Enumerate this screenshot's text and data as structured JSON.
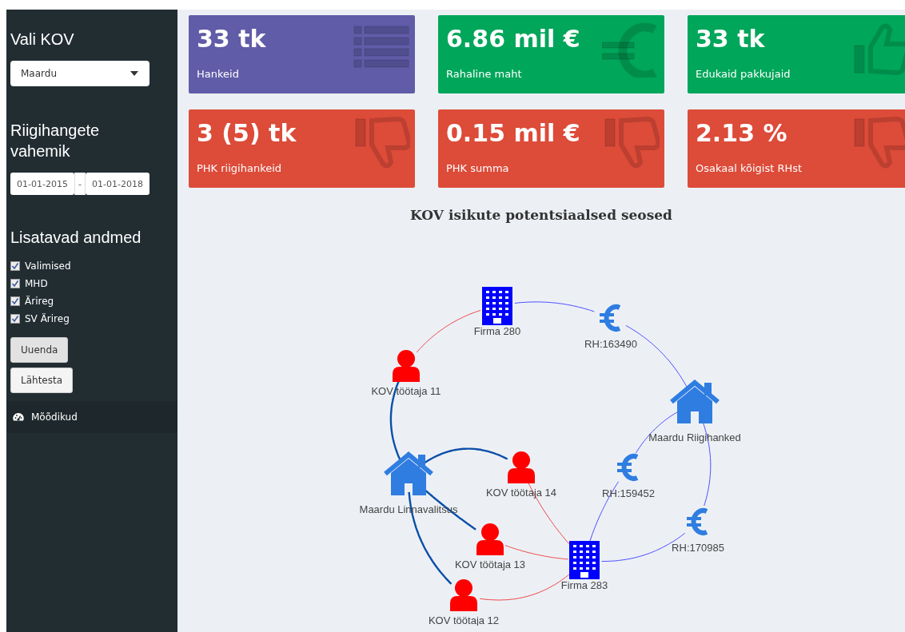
{
  "sidebar": {
    "kov_heading": "Vali KOV",
    "kov_select": {
      "value": "Maardu"
    },
    "range_heading": "Riigihangete vahemik",
    "date_range": {
      "start": "01-01-2015",
      "separator": "-",
      "end": "01-01-2018"
    },
    "data_heading": "Lisatavad andmed",
    "checkboxes": [
      {
        "label": "Valimised",
        "checked": true
      },
      {
        "label": "MHD",
        "checked": true
      },
      {
        "label": "Ärireg",
        "checked": true
      },
      {
        "label": "SV Ärireg",
        "checked": true
      }
    ],
    "buttons": [
      {
        "label": "Uuenda",
        "kind": "pressed"
      },
      {
        "label": "Lähtesta",
        "kind": "plain"
      }
    ],
    "menu": [
      {
        "label": "Mõõdikud",
        "selected": true
      }
    ]
  },
  "value_boxes": [
    {
      "value": "33 tk",
      "label": "Hankeid",
      "color": "#605ca8",
      "kind": "count"
    },
    {
      "value": "6.86 mil €",
      "label": "Rahaline maht",
      "color": "#00a65a",
      "kind": "money"
    },
    {
      "value": "33 tk",
      "label": "Edukaid pakkujaid",
      "color": "#00a65a",
      "kind": "good"
    },
    {
      "value": "3 (5) tk",
      "label": "PHK riigihankeid",
      "color": "#dd4b39",
      "kind": "bad"
    },
    {
      "value": "0.15 mil €",
      "label": "PHK summa",
      "color": "#dd4b39",
      "kind": "bad"
    },
    {
      "value": "2.13 %",
      "label": "Osakaal kõigist RHst",
      "color": "#dd4b39",
      "kind": "bad"
    }
  ],
  "network": {
    "title": "KOV isikute potentsiaalsed seosed",
    "nodes": [
      {
        "kind": "company",
        "label": "Firma 280"
      },
      {
        "kind": "procurement",
        "label": "RH:163490"
      },
      {
        "kind": "person",
        "label": "KOV töötaja 11"
      },
      {
        "kind": "authority",
        "label": "Maardu Riigihanked"
      },
      {
        "kind": "authority",
        "label": "Maardu Linnavalitsus"
      },
      {
        "kind": "person",
        "label": "KOV töötaja 14"
      },
      {
        "kind": "procurement",
        "label": "RH:159452"
      },
      {
        "kind": "procurement",
        "label": "RH:170985"
      },
      {
        "kind": "person",
        "label": "KOV töötaja 13"
      },
      {
        "kind": "company",
        "label": "Firma 283"
      },
      {
        "kind": "person",
        "label": "KOV töötaja 12"
      }
    ],
    "edges": [
      {
        "kind": "procurement"
      },
      {
        "kind": "procurement"
      },
      {
        "kind": "association"
      },
      {
        "kind": "employment"
      },
      {
        "kind": "employment"
      },
      {
        "kind": "employment"
      },
      {
        "kind": "employment"
      },
      {
        "kind": "association"
      },
      {
        "kind": "association"
      },
      {
        "kind": "association"
      },
      {
        "kind": "procurement"
      },
      {
        "kind": "procurement"
      },
      {
        "kind": "procurement"
      },
      {
        "kind": "procurement"
      }
    ]
  }
}
